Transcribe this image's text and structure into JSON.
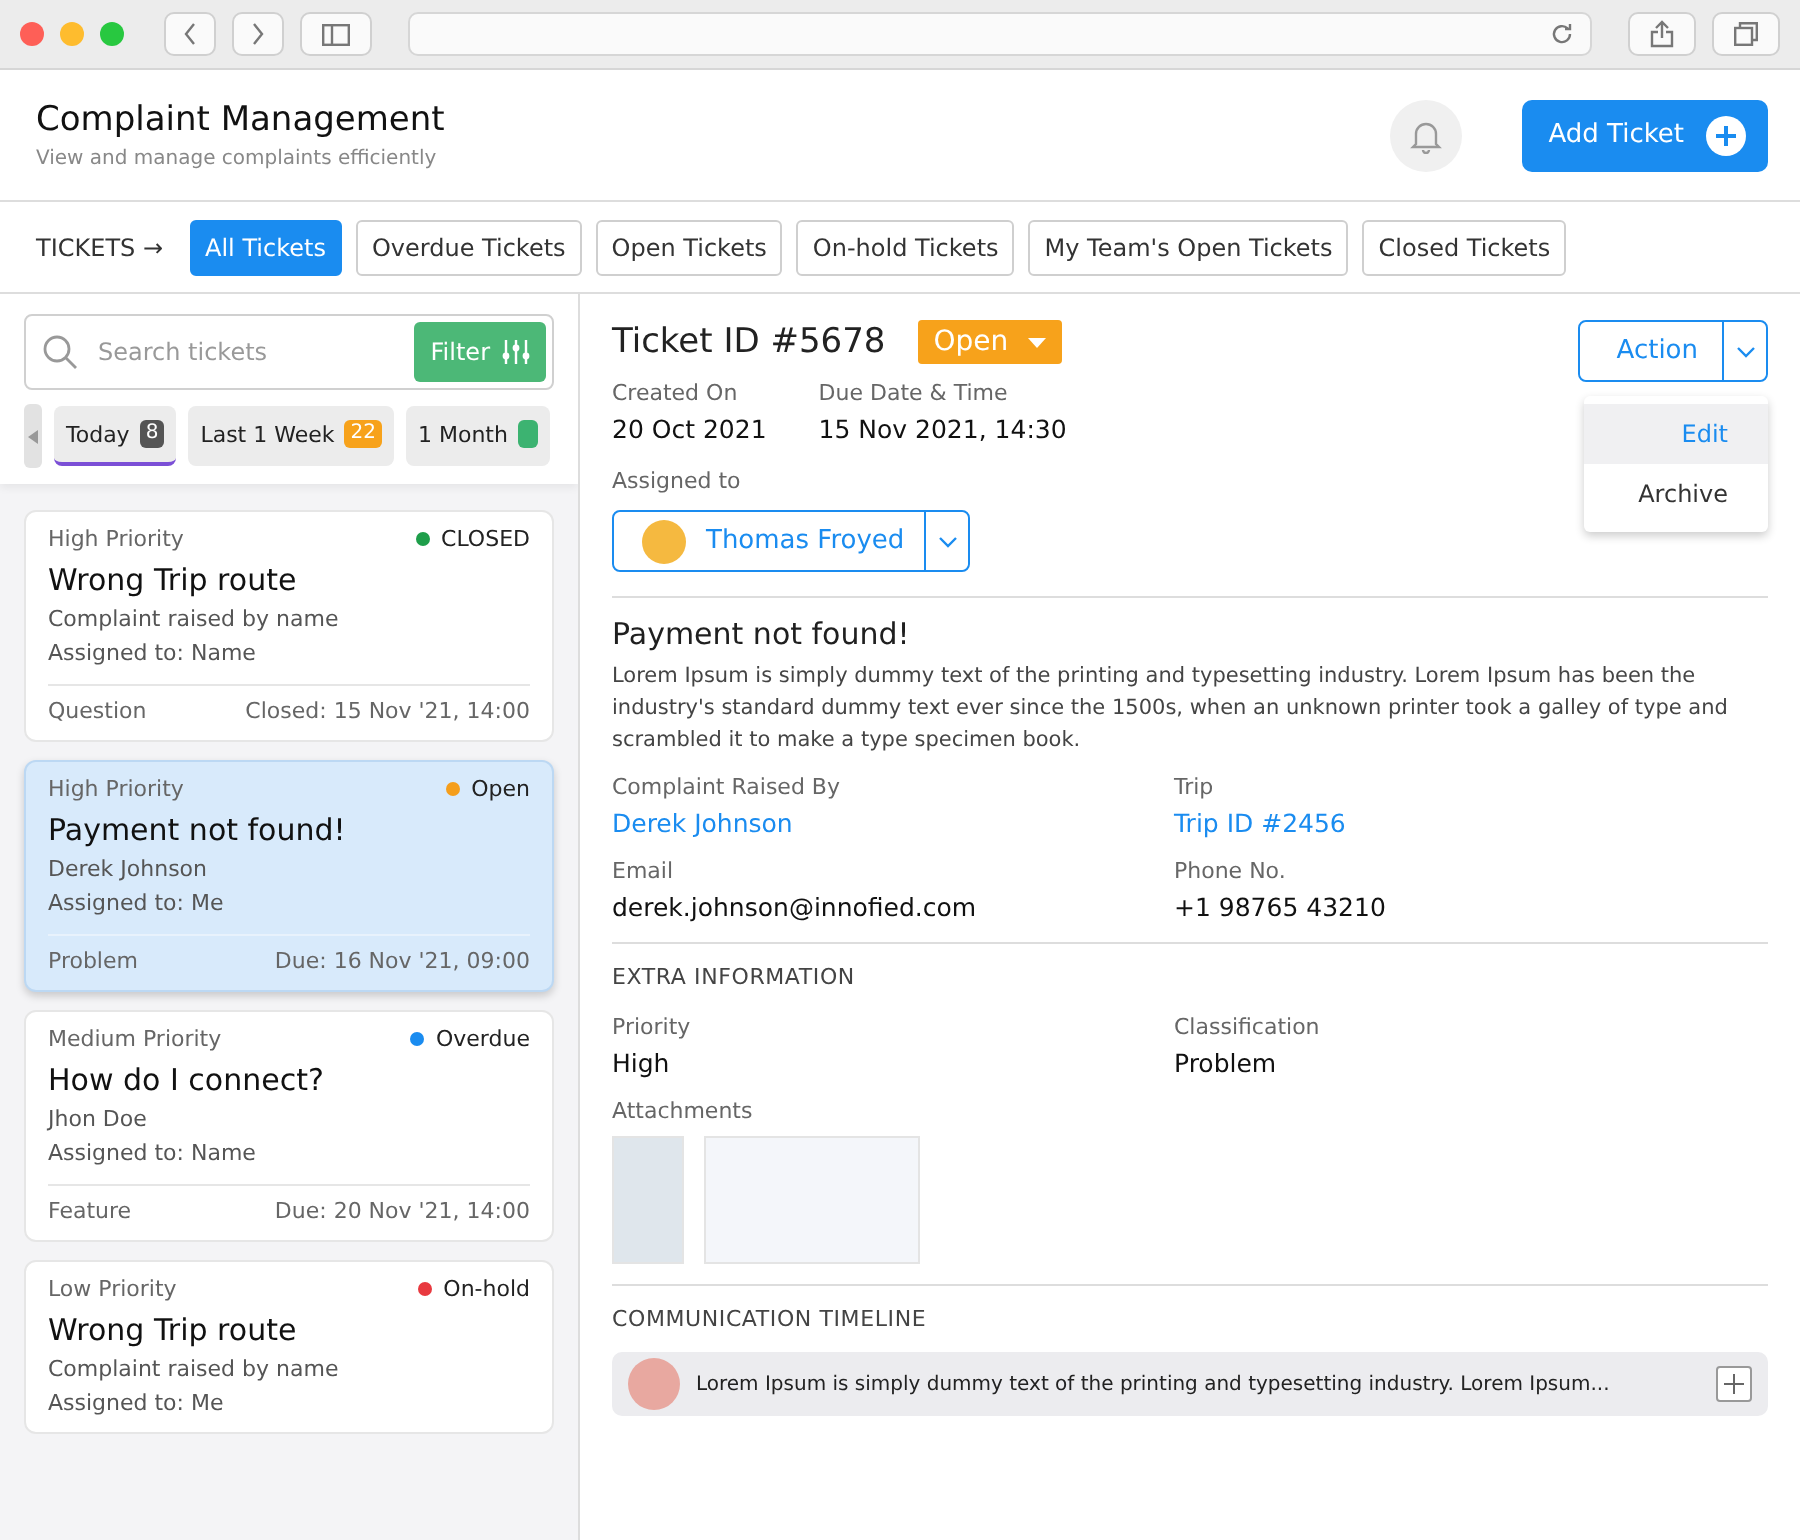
{
  "header": {
    "title": "Complaint Management",
    "subtitle": "View and manage complaints efficiently",
    "add_button": "Add Ticket"
  },
  "tabs_label": "TICKETS →",
  "tabs": [
    {
      "label": "All Tickets",
      "selected": true
    },
    {
      "label": "Overdue Tickets",
      "selected": false
    },
    {
      "label": "Open Tickets",
      "selected": false
    },
    {
      "label": "On-hold Tickets",
      "selected": false
    },
    {
      "label": "My Team's Open Tickets",
      "selected": false
    },
    {
      "label": "Closed Tickets",
      "selected": false
    }
  ],
  "search": {
    "placeholder": "Search tickets",
    "filter_button": "Filter"
  },
  "periods": [
    {
      "label": "Today",
      "count": "8",
      "selected": true,
      "color": "#555555"
    },
    {
      "label": "Last 1 Week",
      "count": "22",
      "selected": false,
      "color": "#f7a21b"
    },
    {
      "label": "1 Month",
      "selected": false,
      "color": "#3cb371"
    }
  ],
  "tickets": [
    {
      "priority": "High Priority",
      "status": "CLOSED",
      "color": "#1e9e4a",
      "title": "Wrong Trip route",
      "raised_by": "Complaint raised by name",
      "assigned": "Assigned to: Name",
      "type": "Question",
      "date": "Closed: 15 Nov '21, 14:00",
      "selected": false
    },
    {
      "priority": "High Priority",
      "status": "Open",
      "color": "#f59e1b",
      "title": "Payment not found!",
      "raised_by": "Derek Johnson",
      "assigned": "Assigned to: Me",
      "type": "Problem",
      "date": "Due: 16 Nov '21, 09:00",
      "selected": true
    },
    {
      "priority": "Medium Priority",
      "status": "Overdue",
      "color": "#1a8cf0",
      "title": "How do I connect?",
      "raised_by": "Jhon Doe",
      "assigned": "Assigned to: Name",
      "type": "Feature",
      "date": "Due: 20 Nov '21, 14:00",
      "selected": false
    },
    {
      "priority": "Low Priority",
      "status": "On-hold",
      "color": "#e8393f",
      "title": "Wrong Trip route",
      "raised_by": "Complaint raised by name",
      "assigned": "Assigned to: Me",
      "selected": false
    }
  ],
  "detail": {
    "ticket_id": "Ticket ID #5678",
    "status": "Open",
    "action": "Action",
    "action_menu": [
      {
        "label": "Edit",
        "selected": true
      },
      {
        "label": "Archive",
        "selected": false
      }
    ],
    "dates": [
      {
        "label": "Created On",
        "value": "20 Oct 2021"
      },
      {
        "label": "Due Date & Time",
        "value": "15 Nov 2021, 14:30"
      }
    ],
    "assigned_label": "Assigned to",
    "assignee": "Thomas Froyed",
    "title": "Payment not found!",
    "description": "Lorem Ipsum is simply dummy text of the printing and typesetting industry. Lorem Ipsum has been the industry's standard dummy text ever since the 1500s, when an unknown printer took a galley of type and scrambled it to make a type specimen book.",
    "fields": [
      {
        "label": "Complaint Raised By",
        "value": "Derek Johnson",
        "kind": "link"
      },
      {
        "label": "Trip",
        "value": "Trip ID #2456",
        "kind": "link"
      },
      {
        "label": "Email",
        "value": "derek.johnson@innofied.com",
        "kind": "text"
      },
      {
        "label": "Phone No.",
        "value": "+1 98765 43210",
        "kind": "text"
      }
    ],
    "extra_heading": "EXTRA INFORMATION",
    "extra": [
      {
        "label": "Priority",
        "value": "High"
      },
      {
        "label": "Classification",
        "value": "Problem"
      }
    ],
    "attachments_label": "Attachments",
    "timeline_heading": "COMMUNICATION TIMELINE",
    "timeline": [
      {
        "text": "Lorem Ipsum is simply dummy text of the printing and typesetting industry. Lorem Ipsum..."
      }
    ]
  }
}
